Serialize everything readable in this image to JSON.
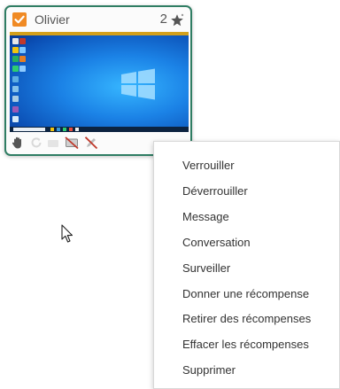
{
  "card": {
    "student_name": "Olivier",
    "star_count": "2",
    "checked": true,
    "accent": "#f08a24",
    "border_color": "#2f7d63"
  },
  "toolbar_icons": [
    "hand-icon",
    "lock-icon",
    "unlock-icon",
    "no-screen-icon",
    "no-edit-icon"
  ],
  "context_menu": {
    "items": [
      "Verrouiller",
      "Déverrouiller",
      "Message",
      "Conversation",
      "Surveiller",
      "Donner une récompense",
      "Retirer des récompenses",
      "Effacer les récompenses",
      "Supprimer"
    ]
  }
}
